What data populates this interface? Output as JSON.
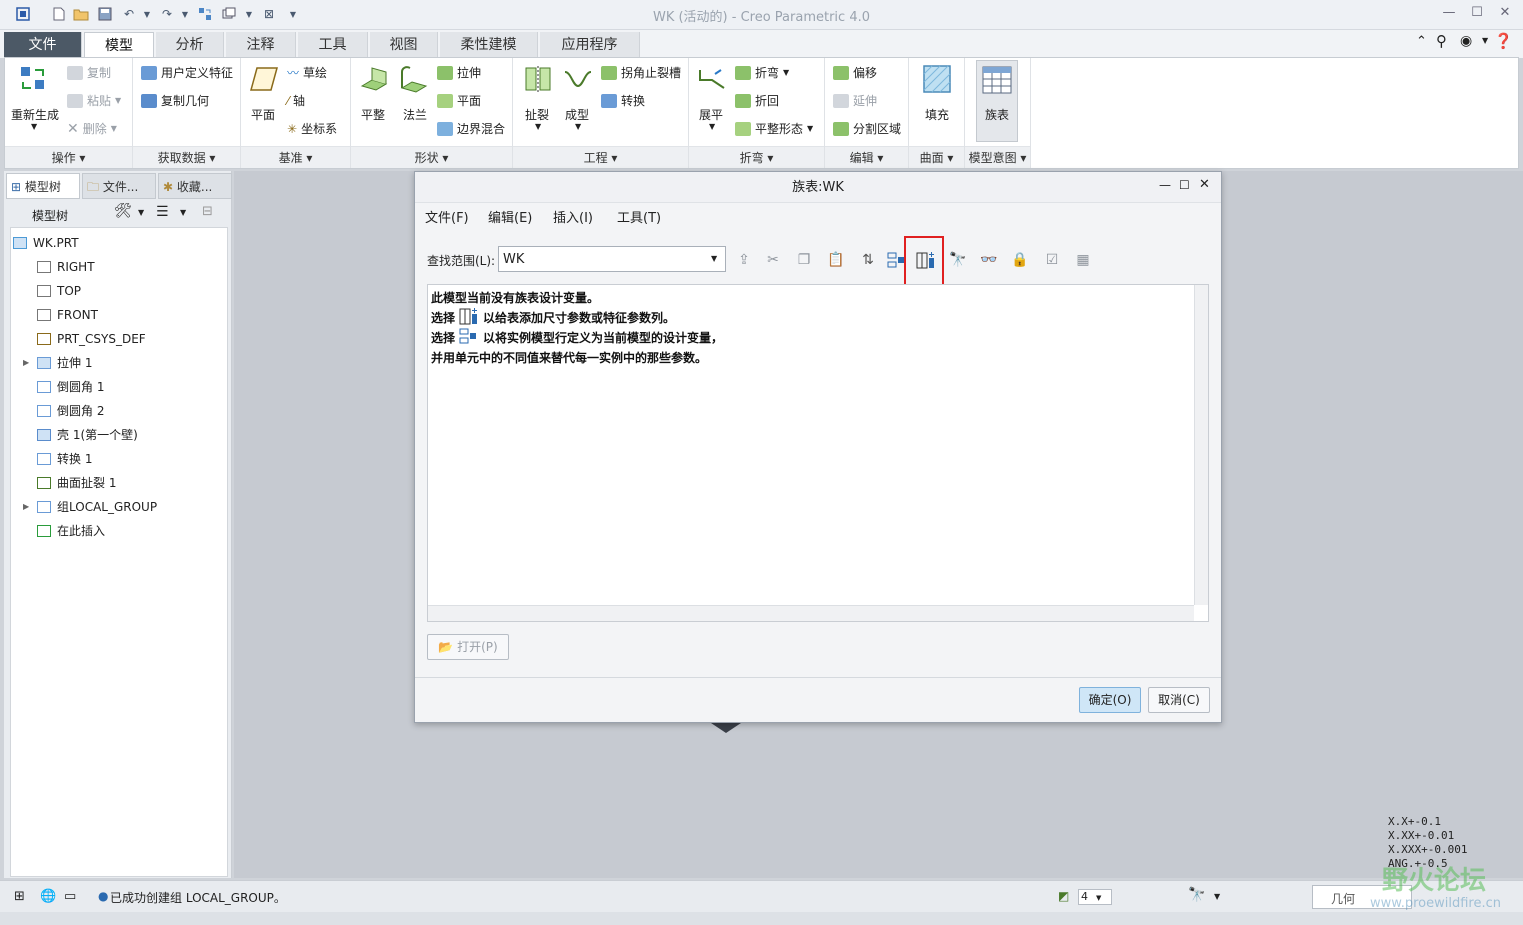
{
  "app": {
    "title": "WK (活动的) - Creo Parametric 4.0"
  },
  "ribbon_tabs": [
    "文件",
    "模型",
    "分析",
    "注释",
    "工具",
    "视图",
    "柔性建模",
    "应用程序"
  ],
  "ribbon": {
    "groups": {
      "operations": {
        "label": "操作",
        "regenerate": "重新生成",
        "copy": "复制",
        "paste": "粘贴",
        "delete": "删除"
      },
      "get_data": {
        "label": "获取数据",
        "udf": "用户定义特征",
        "copy_geom": "复制几何"
      },
      "datum": {
        "label": "基准",
        "plane": "平面",
        "sketch": "草绘",
        "axis": "轴",
        "csys": "坐标系"
      },
      "shapes": {
        "label": "形状",
        "flat": "平整",
        "flange": "法兰",
        "extrude": "拉伸",
        "planar": "平面",
        "blend": "边界混合"
      },
      "engineering": {
        "label": "工程",
        "rip": "扯裂",
        "form": "成型",
        "corner_relief": "拐角止裂槽",
        "convert": "转换"
      },
      "bends": {
        "label": "折弯",
        "unbend": "展平",
        "bend": "折弯",
        "bend_back": "折回",
        "flat_state": "平整形态"
      },
      "editing": {
        "label": "编辑",
        "offset": "偏移",
        "extend": "延伸",
        "split": "分割区域"
      },
      "surfaces": {
        "label": "曲面",
        "fill": "填充"
      },
      "model_intent": {
        "label": "模型意图",
        "family_table": "族表"
      }
    }
  },
  "left_panel": {
    "tabs": [
      "模型树",
      "文件...",
      "收藏..."
    ],
    "header": "模型树",
    "tree": [
      {
        "label": "WK.PRT",
        "indent": 0,
        "expand": ""
      },
      {
        "label": "RIGHT",
        "indent": 1,
        "expand": ""
      },
      {
        "label": "TOP",
        "indent": 1,
        "expand": ""
      },
      {
        "label": "FRONT",
        "indent": 1,
        "expand": ""
      },
      {
        "label": "PRT_CSYS_DEF",
        "indent": 1,
        "expand": ""
      },
      {
        "label": "拉伸 1",
        "indent": 1,
        "expand": "▶"
      },
      {
        "label": "倒圆角 1",
        "indent": 1,
        "expand": ""
      },
      {
        "label": "倒圆角 2",
        "indent": 1,
        "expand": ""
      },
      {
        "label": "壳 1(第一个壁)",
        "indent": 1,
        "expand": ""
      },
      {
        "label": "转换 1",
        "indent": 1,
        "expand": ""
      },
      {
        "label": "曲面扯裂 1",
        "indent": 1,
        "expand": ""
      },
      {
        "label": "组LOCAL_GROUP",
        "indent": 1,
        "expand": "▶"
      },
      {
        "label": "在此插入",
        "indent": 1,
        "expand": ""
      }
    ]
  },
  "dialog": {
    "title": "族表:WK",
    "menu": [
      "文件(F)",
      "编辑(E)",
      "插入(I)",
      "工具(T)"
    ],
    "lookup_label": "查找范围(L):",
    "lookup_value": "WK",
    "messages": [
      "此模型当前没有族表设计变量。",
      "以给表添加尺寸参数或特征参数列。",
      "以将实例模型行定义为当前模型的设计变量，",
      "并用单元中的不同值来替代每一实例中的那些参数。"
    ],
    "select_word": "选择",
    "open_button": "打开(P)",
    "ok_button": "确定(O)",
    "cancel_button": "取消(C)"
  },
  "status": {
    "message": "已成功创建组 LOCAL_GROUP。",
    "count": "4",
    "filter": "几何"
  },
  "tolerance": [
    "X.X+-0.1",
    "X.XX+-0.01",
    "X.XXX+-0.001",
    "ANG.+-0.5"
  ],
  "watermark": {
    "name": "野火论坛",
    "url": "www.proewildfire.cn"
  },
  "colors": {
    "accent_red": "#e02020",
    "file_tab": "#4c5966",
    "ok_button": "#cfe6f7"
  }
}
